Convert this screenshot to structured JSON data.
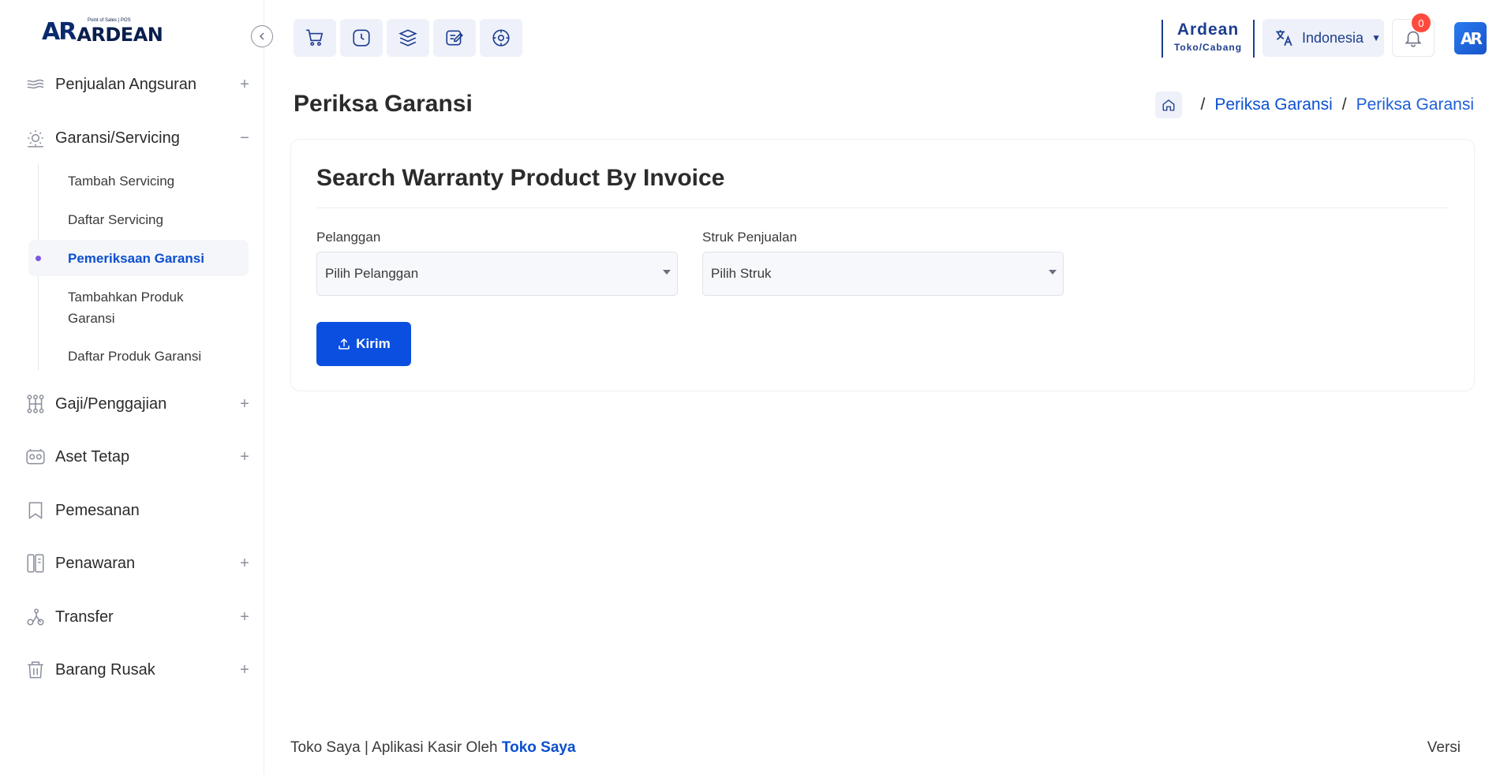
{
  "logo": {
    "mark": "AR",
    "text": "ARDEAN",
    "tagline": "Point of Sales | POS"
  },
  "sidebar": {
    "items": [
      {
        "label": "Penjualan Angsuran",
        "toggle": "+"
      },
      {
        "label": "Garansi/Servicing",
        "toggle": "−"
      },
      {
        "label": "Gaji/Penggajian",
        "toggle": "+"
      },
      {
        "label": "Aset Tetap",
        "toggle": "+"
      },
      {
        "label": "Pemesanan",
        "toggle": ""
      },
      {
        "label": "Penawaran",
        "toggle": "+"
      },
      {
        "label": "Transfer",
        "toggle": "+"
      },
      {
        "label": "Barang Rusak",
        "toggle": "+"
      }
    ],
    "sub_items": [
      {
        "label": "Tambah Servicing"
      },
      {
        "label": "Daftar Servicing"
      },
      {
        "label": "Pemeriksaan Garansi"
      },
      {
        "label": "Tambahkan Produk Garansi"
      },
      {
        "label": "Daftar Produk Garansi"
      }
    ]
  },
  "header": {
    "store_name": "Ardean",
    "store_sub": "Toko/Cabang",
    "language": "Indonesia",
    "notifications": "0",
    "avatar": "AR"
  },
  "page": {
    "title": "Periksa Garansi",
    "breadcrumb": [
      "Periksa Garansi",
      "Periksa Garansi"
    ]
  },
  "card": {
    "title": "Search Warranty Product By Invoice",
    "customer_label": "Pelanggan",
    "customer_value": "Pilih Pelanggan",
    "receipt_label": "Struk Penjualan",
    "receipt_value": "Pilih Struk",
    "submit_label": "Kirim"
  },
  "footer": {
    "text": "Toko Saya | Aplikasi Kasir Oleh ",
    "brand": "Toko Saya",
    "version": "Versi"
  },
  "colors": {
    "accent": "#0b4fe0",
    "brand": "#1c3d8f",
    "badge": "#ff4b3e",
    "active_dot": "#7c55e6"
  }
}
